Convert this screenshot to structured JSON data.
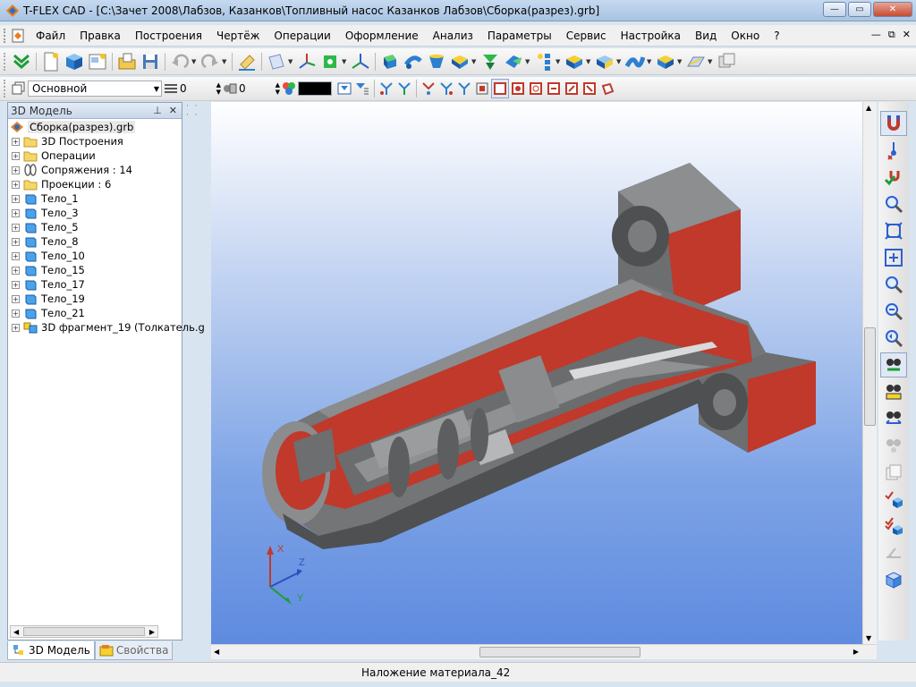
{
  "window": {
    "title": "T-FLEX CAD - [C:\\Зачет 2008\\Лабзов, Казанков\\Топливный насос Казанков Лабзов\\Сборка(разрез).grb]",
    "btn_min": "—",
    "btn_max": "▭",
    "btn_close": "✕"
  },
  "menu": {
    "items": [
      "Файл",
      "Правка",
      "Построения",
      "Чертёж",
      "Операции",
      "Оформление",
      "Анализ",
      "Параметры",
      "Сервис",
      "Настройка",
      "Вид",
      "Окно",
      "?"
    ],
    "mdi_min": "—",
    "mdi_restore": "⧉",
    "mdi_close": "✕"
  },
  "toolbar2": {
    "layer_value": "Основной",
    "spin1_value": "0",
    "spin2_value": "0",
    "color_value": "#000000"
  },
  "left_panel": {
    "title": "3D Модель",
    "pin": "⊥",
    "close": "✕",
    "tree": [
      {
        "label": "Сборка(разрез).grb",
        "icon": "assembly-icon",
        "root": true
      },
      {
        "label": "3D Построения",
        "icon": "folder-icon"
      },
      {
        "label": "Операции",
        "icon": "folder-icon"
      },
      {
        "label": "Сопряжения : 14",
        "icon": "constraints-icon"
      },
      {
        "label": "Проекции : 6",
        "icon": "folder-icon"
      },
      {
        "label": "Тело_1",
        "icon": "body-icon"
      },
      {
        "label": "Тело_3",
        "icon": "body-icon"
      },
      {
        "label": "Тело_5",
        "icon": "body-icon"
      },
      {
        "label": "Тело_8",
        "icon": "body-icon"
      },
      {
        "label": "Тело_10",
        "icon": "body-icon"
      },
      {
        "label": "Тело_15",
        "icon": "body-icon"
      },
      {
        "label": "Тело_17",
        "icon": "body-icon"
      },
      {
        "label": "Тело_19",
        "icon": "body-icon"
      },
      {
        "label": "Тело_21",
        "icon": "body-icon"
      },
      {
        "label": "3D фрагмент_19 (Толкатель.g",
        "icon": "fragment-icon"
      }
    ]
  },
  "tabs": {
    "model": "3D Модель",
    "properties": "Свойства"
  },
  "viewport": {
    "axis_x": "X",
    "axis_y": "Y",
    "axis_z": "Z"
  },
  "status": {
    "text": "Наложение материала_42"
  },
  "colors": {
    "section_red": "#c0392b",
    "metal_gray": "#6e7072",
    "bg_top": "#ffffff",
    "bg_bottom": "#5f8be0"
  }
}
